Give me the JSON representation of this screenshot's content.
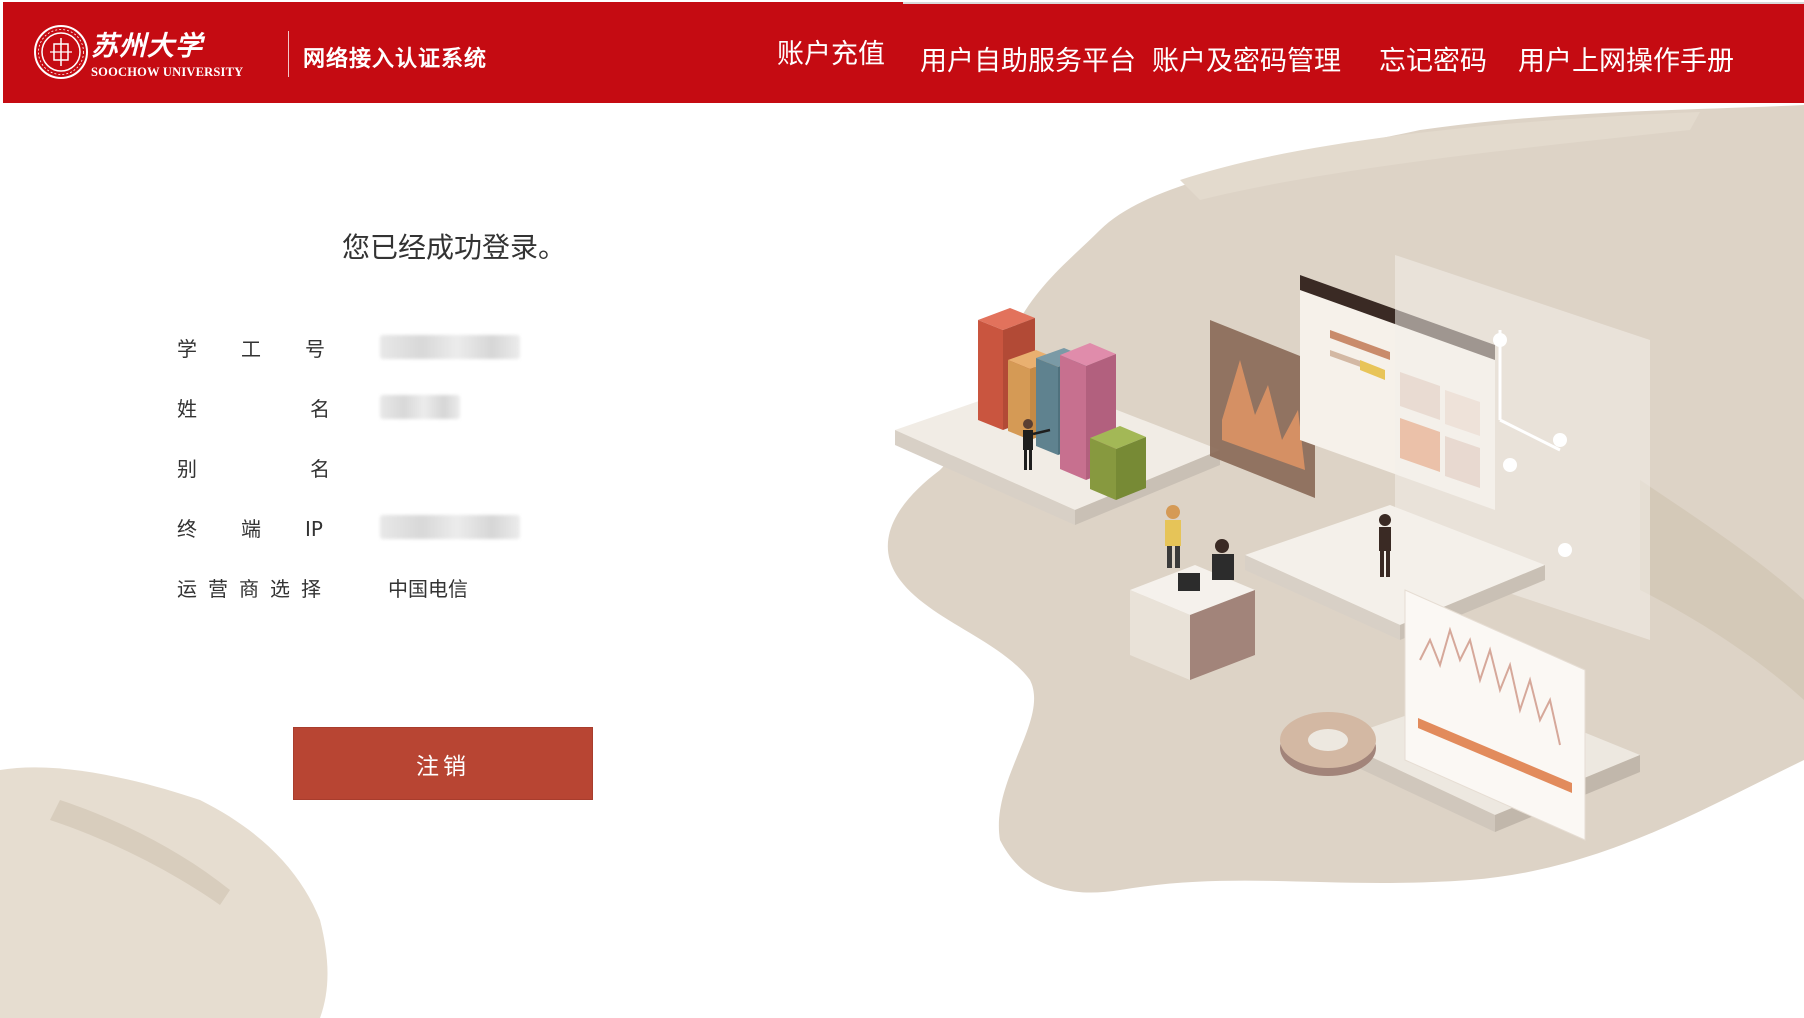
{
  "header": {
    "logo": {
      "cn": "苏州大学",
      "en": "SOOCHOW UNIVERSITY",
      "emblem_icon": "soochow-university-emblem"
    },
    "system_title": "网络接入认证系统",
    "nav": [
      {
        "label": "账户充值"
      },
      {
        "label": "用户自助服务平台"
      },
      {
        "label": "账户及密码管理"
      },
      {
        "label": "忘记密码"
      },
      {
        "label": "用户上网操作手册"
      }
    ],
    "brand_color": "#c50b12"
  },
  "main": {
    "status_message": "您已经成功登录。",
    "fields": [
      {
        "label": "学    工    号",
        "value": ""
      },
      {
        "label": "姓             名",
        "value": ""
      },
      {
        "label": "别             名",
        "value": ""
      },
      {
        "label": "终    端    IP",
        "value": ""
      },
      {
        "label": "运 营 商 选 择",
        "value": "中国电信"
      }
    ],
    "logout_label": "注销",
    "button_color": "#b84533"
  }
}
